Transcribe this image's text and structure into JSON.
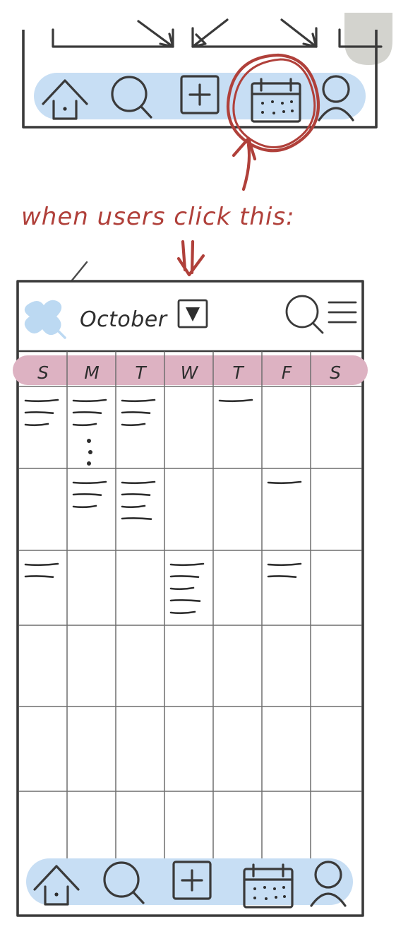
{
  "meta": {
    "kind": "hand-drawn-wireframe-sketch",
    "colors": {
      "tabbar_blue": "#c7def4",
      "weekday_pink": "#ddb2c2",
      "annotation_red": "#b0403a",
      "pin_blue": "#bcd9f2",
      "ink": "#2e2e2e",
      "grid_line": "#6e6e6e",
      "gray_blob": "#cbcbc6"
    }
  },
  "annotation": {
    "text": "when users click this:",
    "circle_target": "calendar-tab-icon",
    "arrow_up_name": "curved-arrow-to-calendar-tab",
    "arrow_down_name": "double-down-arrow"
  },
  "top_screen": {
    "name": "partial-screen-above",
    "tabbar": {
      "items": [
        {
          "icon": "home-icon",
          "label": "Home"
        },
        {
          "icon": "search-icon",
          "label": "Search"
        },
        {
          "icon": "add-icon",
          "label": "Add"
        },
        {
          "icon": "calendar-icon",
          "label": "Calendar"
        },
        {
          "icon": "profile-icon",
          "label": "Profile"
        }
      ],
      "highlighted_index": 3
    },
    "brackets": [
      {
        "name": "measure-bracket-left"
      },
      {
        "name": "measure-bracket-middle"
      },
      {
        "name": "measure-bracket-right"
      }
    ]
  },
  "calendar_screen": {
    "name": "calendar-month-screen",
    "header": {
      "pin_icon": "pin-icon",
      "month": "October",
      "dropdown_icon": "chevron-down-icon",
      "search_icon": "search-icon",
      "menu_icon": "hamburger-menu-icon"
    },
    "weekdays": [
      "S",
      "M",
      "T",
      "W",
      "T",
      "F",
      "S"
    ],
    "grid": {
      "rows": 6,
      "columns": 7,
      "events": [
        {
          "row": 0,
          "col": 0,
          "lines": 3,
          "dots": 0
        },
        {
          "row": 0,
          "col": 1,
          "lines": 3,
          "dots": 3
        },
        {
          "row": 0,
          "col": 2,
          "lines": 3,
          "dots": 0
        },
        {
          "row": 0,
          "col": 4,
          "lines": 1,
          "dots": 0
        },
        {
          "row": 1,
          "col": 1,
          "lines": 3,
          "dots": 0
        },
        {
          "row": 1,
          "col": 2,
          "lines": 4,
          "dots": 0
        },
        {
          "row": 1,
          "col": 5,
          "lines": 1,
          "dots": 0
        },
        {
          "row": 2,
          "col": 0,
          "lines": 2,
          "dots": 0
        },
        {
          "row": 2,
          "col": 3,
          "lines": 5,
          "dots": 0
        },
        {
          "row": 2,
          "col": 5,
          "lines": 2,
          "dots": 0
        }
      ]
    },
    "tabbar": {
      "items": [
        {
          "icon": "home-icon",
          "label": "Home"
        },
        {
          "icon": "search-icon",
          "label": "Search"
        },
        {
          "icon": "add-icon",
          "label": "Add"
        },
        {
          "icon": "calendar-icon",
          "label": "Calendar"
        },
        {
          "icon": "profile-icon",
          "label": "Profile"
        }
      ],
      "highlighted_index": 3
    }
  }
}
